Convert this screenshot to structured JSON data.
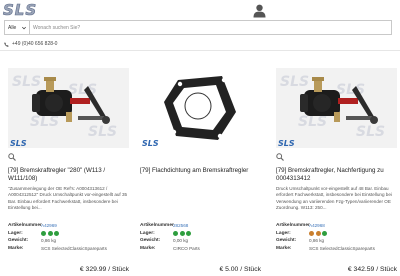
{
  "header": {
    "logo_text": "SLS",
    "search": {
      "select_value": "Alle",
      "placeholder": "Wonach suchen Sie?"
    },
    "phone": "+49 (0)40 656 828-0"
  },
  "products": [
    {
      "title": "[79] Bremskraftregler \"280\" (W113 / W111/108)",
      "description": "\"Zusammenlegung der OE Ref's: A0004313612 / A0004312512\" Druck Umschaltpunkt vor-eingestellt auf 35 Bar. Einbau erfordert Fachwerkstatt, insbesondere bei Einstellung bei...",
      "article_label": "Artikelnummer",
      "article_no": "A42969",
      "stock_label": "Lager:",
      "stock_dots": [
        "#2e9e3e",
        "#2e9e3e",
        "#2e9e3e"
      ],
      "weight_label": "Gewicht:",
      "weight": "0,86 kg",
      "brand_label": "Marke:",
      "brand": "SCS SelectedClassicSpareparts",
      "price": "€ 329.99 / Stück"
    },
    {
      "title": "[79] Flachdichtung am Bremskraftregler",
      "description": "",
      "article_label": "Artikelnummer",
      "article_no": "282568",
      "stock_label": "Lager:",
      "stock_dots": [
        "#2e9e3e",
        "#2e9e3e",
        "#2e9e3e"
      ],
      "weight_label": "Gewicht:",
      "weight": "0,00 kg",
      "brand_label": "Marke:",
      "brand": "CIRCO Parts",
      "price": "€ 5.00 / Stück"
    },
    {
      "title": "[79] Bremskraftregler, Nachfertigung zu 0004313412",
      "description": "Druck Umschaltpunkt vor-eingestellt auf 48 Bar. Einbau erfordert Fachwerkstatt, insbesondere bei Einstellung bei Verwendung an variierenden Fzg-Typen/variierender OE Zuordnung. W113: 250...",
      "article_label": "Artikelnummer",
      "article_no": "A42968",
      "stock_label": "Lager:",
      "stock_dots": [
        "#c97f2e",
        "#c97f2e",
        "#2e9e3e"
      ],
      "weight_label": "Gewicht:",
      "weight": "0,86 kg",
      "brand_label": "Marke:",
      "brand": "SCS SelectedClassicSpareparts",
      "price": "€ 342.59 / Stück"
    }
  ]
}
